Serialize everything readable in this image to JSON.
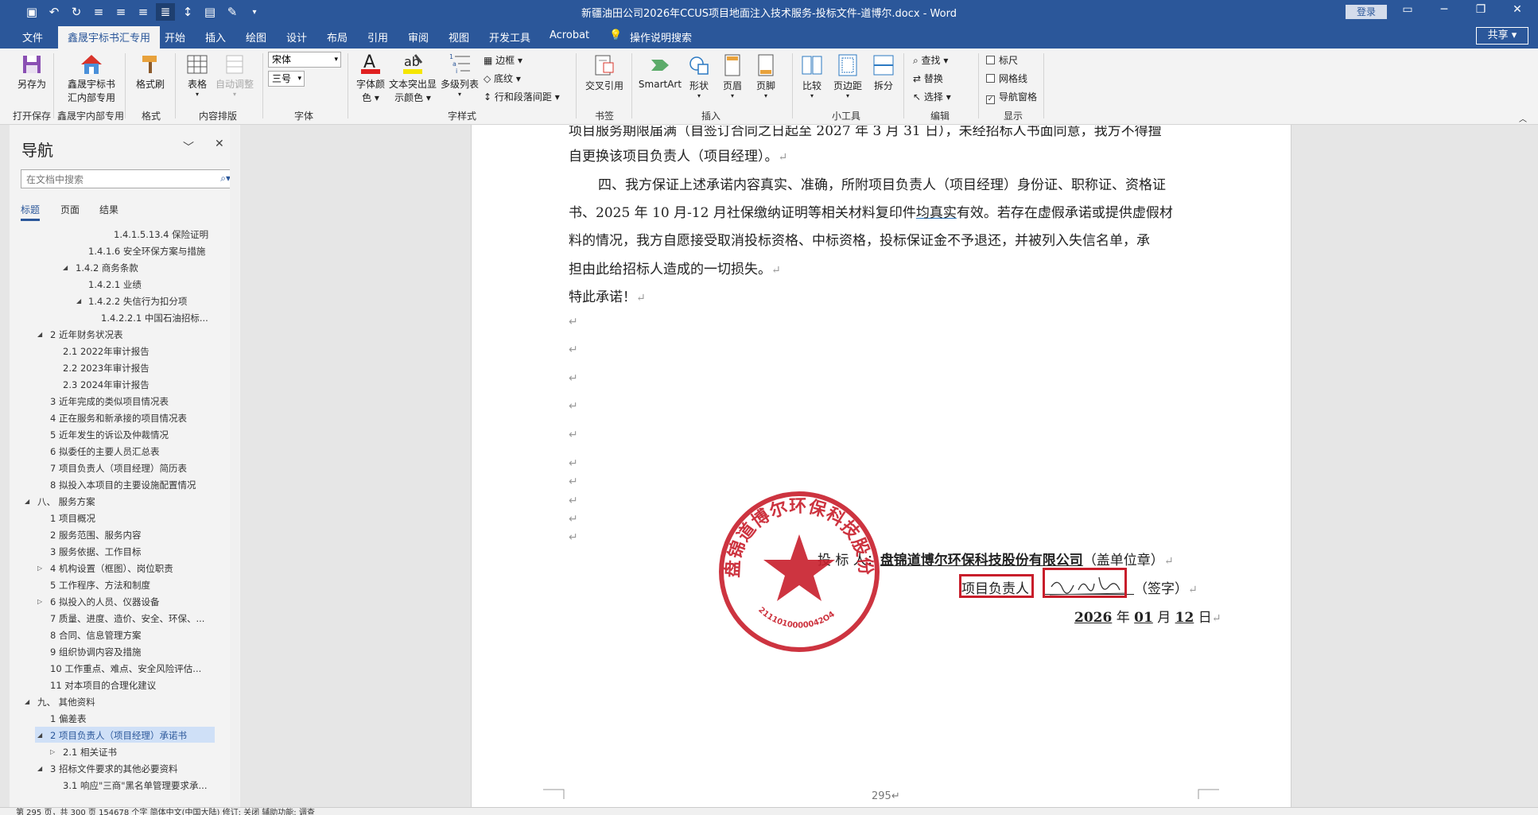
{
  "title_bar": {
    "document_title": "新疆油田公司2026年CCUS项目地面注入技术服务-投标文件-道博尔.docx  -  Word",
    "login_label": "登录",
    "qat_icons": [
      "save-icon",
      "undo-icon",
      "redo-icon",
      "align-left-icon",
      "align-center-icon",
      "align-right-icon",
      "justify-icon",
      "line-spacing-icon",
      "save-as-icon",
      "format-painter-icon",
      "customize-icon"
    ]
  },
  "tabs": [
    "文件",
    "鑫晟宇标书汇专用",
    "开始",
    "插入",
    "绘图",
    "设计",
    "布局",
    "引用",
    "审阅",
    "视图",
    "开发工具",
    "Acrobat"
  ],
  "tell_me": "操作说明搜索",
  "share_label": "共享",
  "ribbon": {
    "save_as": "另存为",
    "xsy_label_1": "鑫晟宇标书",
    "xsy_label_2": "汇内部专用",
    "format_painter": "格式刷",
    "table": "表格",
    "auto_adjust": "自动调整",
    "font_name": "宋体",
    "font_size": "三号",
    "font_color_1": "字体颜",
    "font_color_2": "色",
    "highlight_1": "文本突出显",
    "highlight_2": "示颜色",
    "multilevel": "多级列表",
    "border": "边框",
    "shading": "底纹",
    "line_para_spacing": "行和段落间距",
    "cross_ref": "交叉引用",
    "smartart": "SmartArt",
    "shapes": "形状",
    "header": "页眉",
    "footer": "页脚",
    "compare": "比较",
    "margins": "页边距",
    "split": "拆分",
    "find": "查找",
    "replace": "替换",
    "select": "选择",
    "ruler": "标尺",
    "gridlines": "网格线",
    "nav_pane": "导航窗格",
    "groups": {
      "open_save": "打开保存",
      "xsy_internal": "鑫晟宇内部专用",
      "format": "格式",
      "content_layout": "内容排版",
      "font": "字体",
      "style": "字样式",
      "bookmark": "书签",
      "insert": "插入",
      "tools": "小工具",
      "edit": "编辑",
      "display": "显示"
    }
  },
  "nav": {
    "title": "导航",
    "search_placeholder": "在文档中搜索",
    "tabs": [
      "标题",
      "页面",
      "结果"
    ],
    "items": [
      "1.4.1.5.13.4 保险证明",
      "1.4.1.6 安全环保方案与措施",
      "1.4.2 商务条款",
      "1.4.2.1 业绩",
      "1.4.2.2 失信行为扣分项",
      "1.4.2.2.1 中国石油招标...",
      "2 近年财务状况表",
      "2.1 2022年审计报告",
      "2.2 2023年审计报告",
      "2.3 2024年审计报告",
      "3 近年完成的类似项目情况表",
      "4 正在服务和新承接的项目情况表",
      "5 近年发生的诉讼及仲裁情况",
      "6 拟委任的主要人员汇总表",
      "7 项目负责人（项目经理）简历表",
      "8 拟投入本项目的主要设施配置情况",
      "八、 服务方案",
      "1 项目概况",
      "2 服务范围、服务内容",
      "3 服务依据、工作目标",
      "4 机构设置（框图）、岗位职责",
      "5 工作程序、方法和制度",
      "6 拟投入的人员、仪器设备",
      "7 质量、进度、造价、安全、环保、...",
      "8 合同、信息管理方案",
      "9 组织协调内容及措施",
      "10 工作重点、难点、安全风险评估...",
      "11 对本项目的合理化建议",
      "九、 其他资料",
      "1 偏差表",
      "2 项目负责人（项目经理）承诺书",
      "2.1 相关证书",
      "3 招标文件要求的其他必要资料",
      "3.1 响应\"三商\"黑名单管理要求承..."
    ]
  },
  "document": {
    "line_top": "项目服务期限届满（自签订合同之日起至 2027 年 3 月 31 日），未经招标人书面同意，我方不得擅",
    "line_1": "自更换该项目负责人（项目经理）。",
    "line_2": "四、我方保证上述承诺内容真实、准确，所附项目负责人（项目经理）身份证、职称证、资格证",
    "line_3_a": "书、2025 年 10 月-12 月社保缴纳证明等相关材料复印件",
    "line_3_b": "均真实",
    "line_3_c": "有效。若存在虚假承诺或提供虚假材",
    "line_4": "料的情况，我方自愿接受取消投标资格、中标资格，投标保证金不予退还，并被列入失信名单，承",
    "line_5": "担由此给招标人造成的一切损失。",
    "line_6": "特此承诺！",
    "bidder_label": "投  标  人：",
    "company": "盘锦道博尔环保科技股份有限公司",
    "seal_note": "（盖单位章）",
    "pm_label": "项目负责人",
    "sign_note": "（签字）",
    "date_year": "2026",
    "date_month": "01",
    "date_day": "12",
    "date_y_char": "年",
    "date_m_char": "月",
    "date_d_char": "日",
    "page_number": "295",
    "return_mark": "↵",
    "stamp_text": "盘锦道博尔环保科技股份有限公司",
    "stamp_number": "2111010000042O4"
  },
  "status_bar": {
    "text": "第 295 页，共 300 页    154678 个字    简体中文(中国大陆)    修订: 关闭    辅助功能: 调查"
  },
  "colors": {
    "accent": "#2b579a",
    "stamp": "#c81e2b",
    "highlight": "#f5e600",
    "font_color": "#e02020"
  }
}
